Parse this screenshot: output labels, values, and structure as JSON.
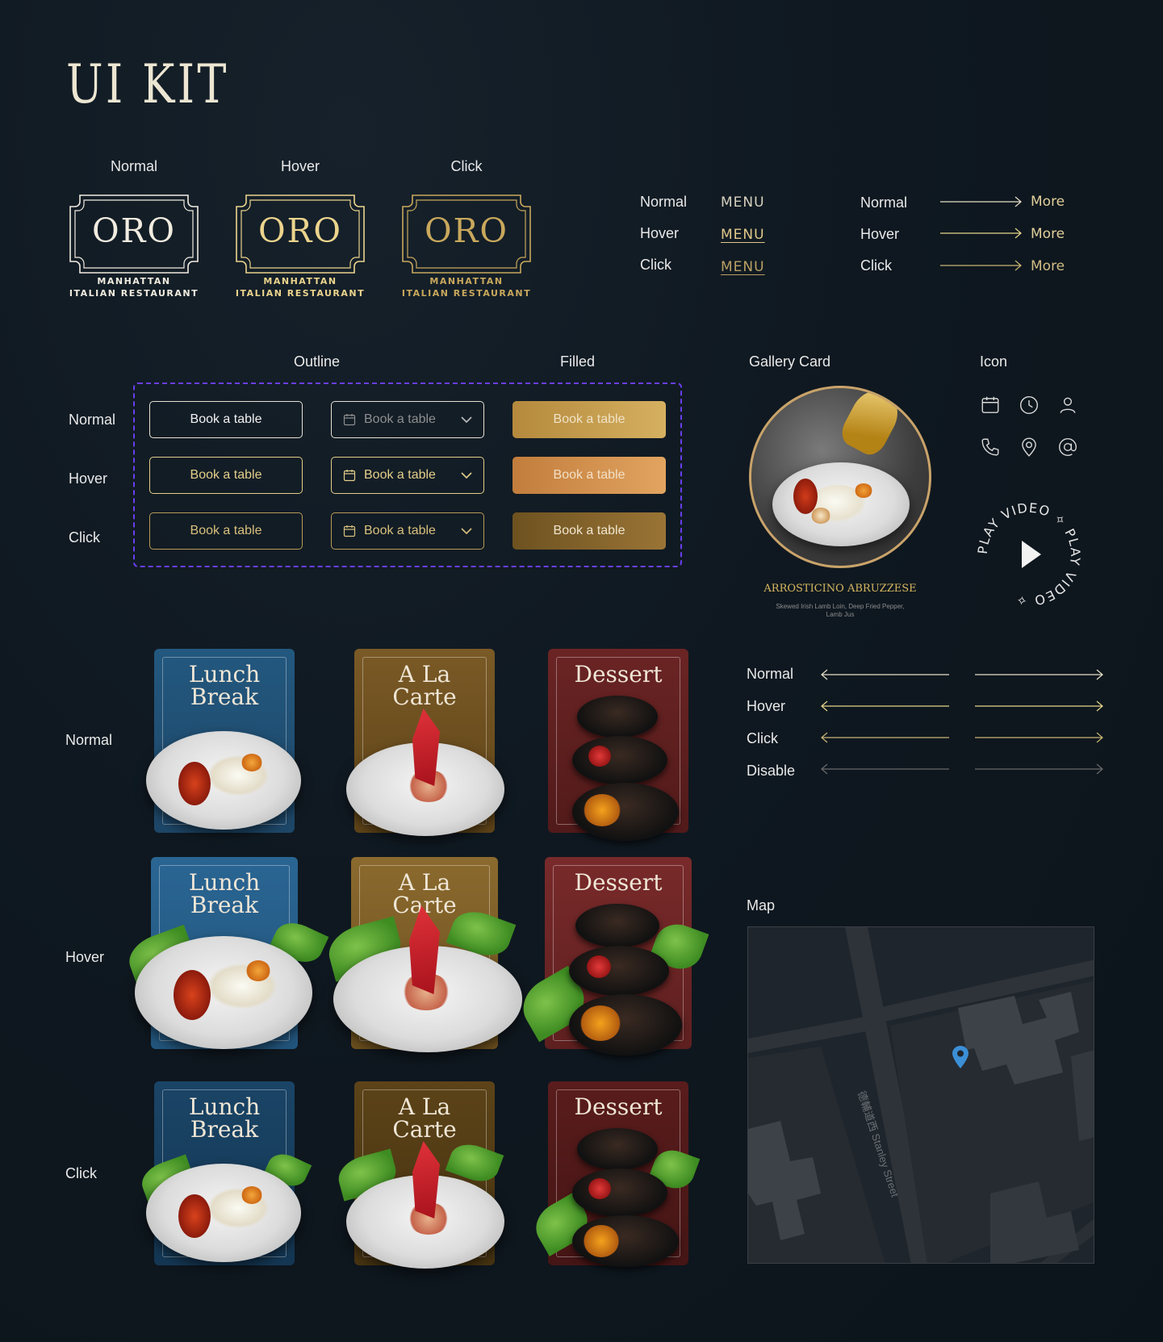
{
  "page": {
    "title": "UI KIT"
  },
  "logo_states": {
    "labels": [
      "Normal",
      "Hover",
      "Click"
    ],
    "brand": "ORO",
    "sub1": "MANHATTAN",
    "sub2": "ITALIAN RESTAURANT",
    "colors": [
      "#f1ece0",
      "#ecd48d",
      "#c9a85c"
    ]
  },
  "menu_states": {
    "labels": [
      "Normal",
      "Hover",
      "Click"
    ],
    "link": "MENU"
  },
  "more_states": {
    "labels": [
      "Normal",
      "Hover",
      "Click"
    ],
    "link": "More"
  },
  "buttons": {
    "col_outline": "Outline",
    "col_filled": "Filled",
    "row_labels": [
      "Normal",
      "Hover",
      "Click"
    ],
    "label": "Book a table",
    "accent": "#6a3ef0"
  },
  "gallery": {
    "heading": "Gallery Card",
    "dish": "ARROSTICINO ABRUZZESE",
    "desc": "Skewed Irish Lamb Loin, Deep Fried Pepper, Lamb Jus"
  },
  "icons": {
    "heading": "Icon",
    "names": [
      "calendar-icon",
      "clock-icon",
      "user-icon",
      "phone-icon",
      "location-pin-icon",
      "at-sign-icon"
    ],
    "play_text": "PLAY VIDEO ✧ PLAY VIDEO ✧ "
  },
  "menu_cards": {
    "row_labels": [
      "Normal",
      "Hover",
      "Click"
    ],
    "titles": [
      [
        "Lunch",
        "Break"
      ],
      [
        "A La",
        "Carte"
      ],
      [
        "Dessert",
        ""
      ]
    ]
  },
  "arrows": {
    "labels": [
      "Normal",
      "Hover",
      "Click",
      "Disable"
    ],
    "colors": [
      "#e8e0c8",
      "#e6d58c",
      "#c9b574",
      "#6a6a6a"
    ]
  },
  "map": {
    "heading": "Map",
    "street": "德輔道西 Stanley Street",
    "pin_color": "#3b8fd6"
  }
}
